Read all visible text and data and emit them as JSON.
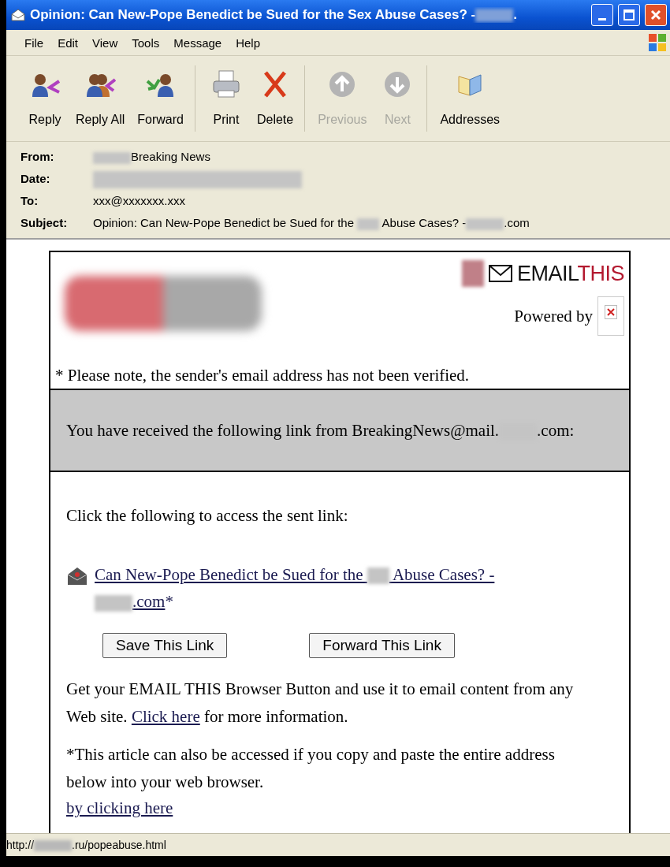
{
  "window": {
    "title": [
      {
        "kind": "text",
        "text": "Opinion: Can New-Pope Benedict be Sued for the Sex Abuse Cases? -"
      },
      {
        "kind": "redacted"
      },
      {
        "kind": "text",
        "text": "."
      }
    ]
  },
  "menu": [
    "File",
    "Edit",
    "View",
    "Tools",
    "Message",
    "Help"
  ],
  "toolbar": [
    [
      {
        "label": "Reply",
        "disabled": false
      },
      {
        "label": "Reply All",
        "disabled": false
      },
      {
        "label": "Forward",
        "disabled": false
      }
    ],
    [
      {
        "label": "Print",
        "disabled": false
      },
      {
        "label": "Delete",
        "disabled": false
      }
    ],
    [
      {
        "label": "Previous",
        "disabled": true
      },
      {
        "label": "Next",
        "disabled": true
      }
    ],
    [
      {
        "label": "Addresses",
        "disabled": false
      }
    ]
  ],
  "header": [
    {
      "label": "From:",
      "value": [
        {
          "kind": "redacted"
        },
        {
          "kind": "text",
          "text": "Breaking News"
        }
      ]
    },
    {
      "label": "Date:",
      "value": [
        {
          "kind": "redacted-wide"
        }
      ]
    },
    {
      "label": "To:",
      "value": [
        {
          "kind": "text",
          "text": "xxx@xxxxxxx.xxx"
        }
      ]
    },
    {
      "label": "Subject:",
      "value": [
        {
          "kind": "text",
          "text": "Opinion: Can New-Pope Benedict be Sued for the "
        },
        {
          "kind": "redacted-small"
        },
        {
          "kind": "text",
          "text": " Abuse Cases? -"
        },
        {
          "kind": "redacted"
        },
        {
          "kind": "text",
          "text": ".com"
        }
      ]
    }
  ],
  "message": {
    "brand": [
      {
        "text": "EMAIL",
        "color": "#111111"
      },
      {
        "text": "THIS",
        "color": "#b3192f"
      }
    ],
    "powered_by": "Powered by",
    "notice": "* Please note, the sender's email address has not been verified.",
    "received": [
      {
        "kind": "text",
        "text": "You have received the following link from BreakingNews@mail."
      },
      {
        "kind": "redacted"
      },
      {
        "kind": "text",
        "text": ".com:"
      }
    ],
    "instruction": "Click the following to access the sent link:",
    "article_link": [
      {
        "kind": "text",
        "text": "Can New-Pope Benedict be Sued for the "
      },
      {
        "kind": "redacted-small"
      },
      {
        "kind": "text",
        "text": " Abuse Cases? - "
      },
      {
        "kind": "redacted"
      },
      {
        "kind": "text",
        "text": ".com"
      }
    ],
    "footnote_mark": "*",
    "buttons": [
      "Save This Link",
      "Forward This Link"
    ],
    "promo": [
      {
        "kind": "text",
        "text": "Get your EMAIL THIS Browser Button and use it to email content from any Web site. "
      },
      {
        "kind": "link",
        "text": "Click here"
      },
      {
        "kind": "text",
        "text": " for more information."
      }
    ],
    "note": "*This article can also be accessed if you copy and paste the entire address below into your web browser.",
    "note_link": "by clicking here"
  },
  "status_bar": [
    {
      "kind": "text",
      "text": "http://"
    },
    {
      "kind": "redacted"
    },
    {
      "kind": "text",
      "text": ".ru/popeabuse.html"
    }
  ]
}
